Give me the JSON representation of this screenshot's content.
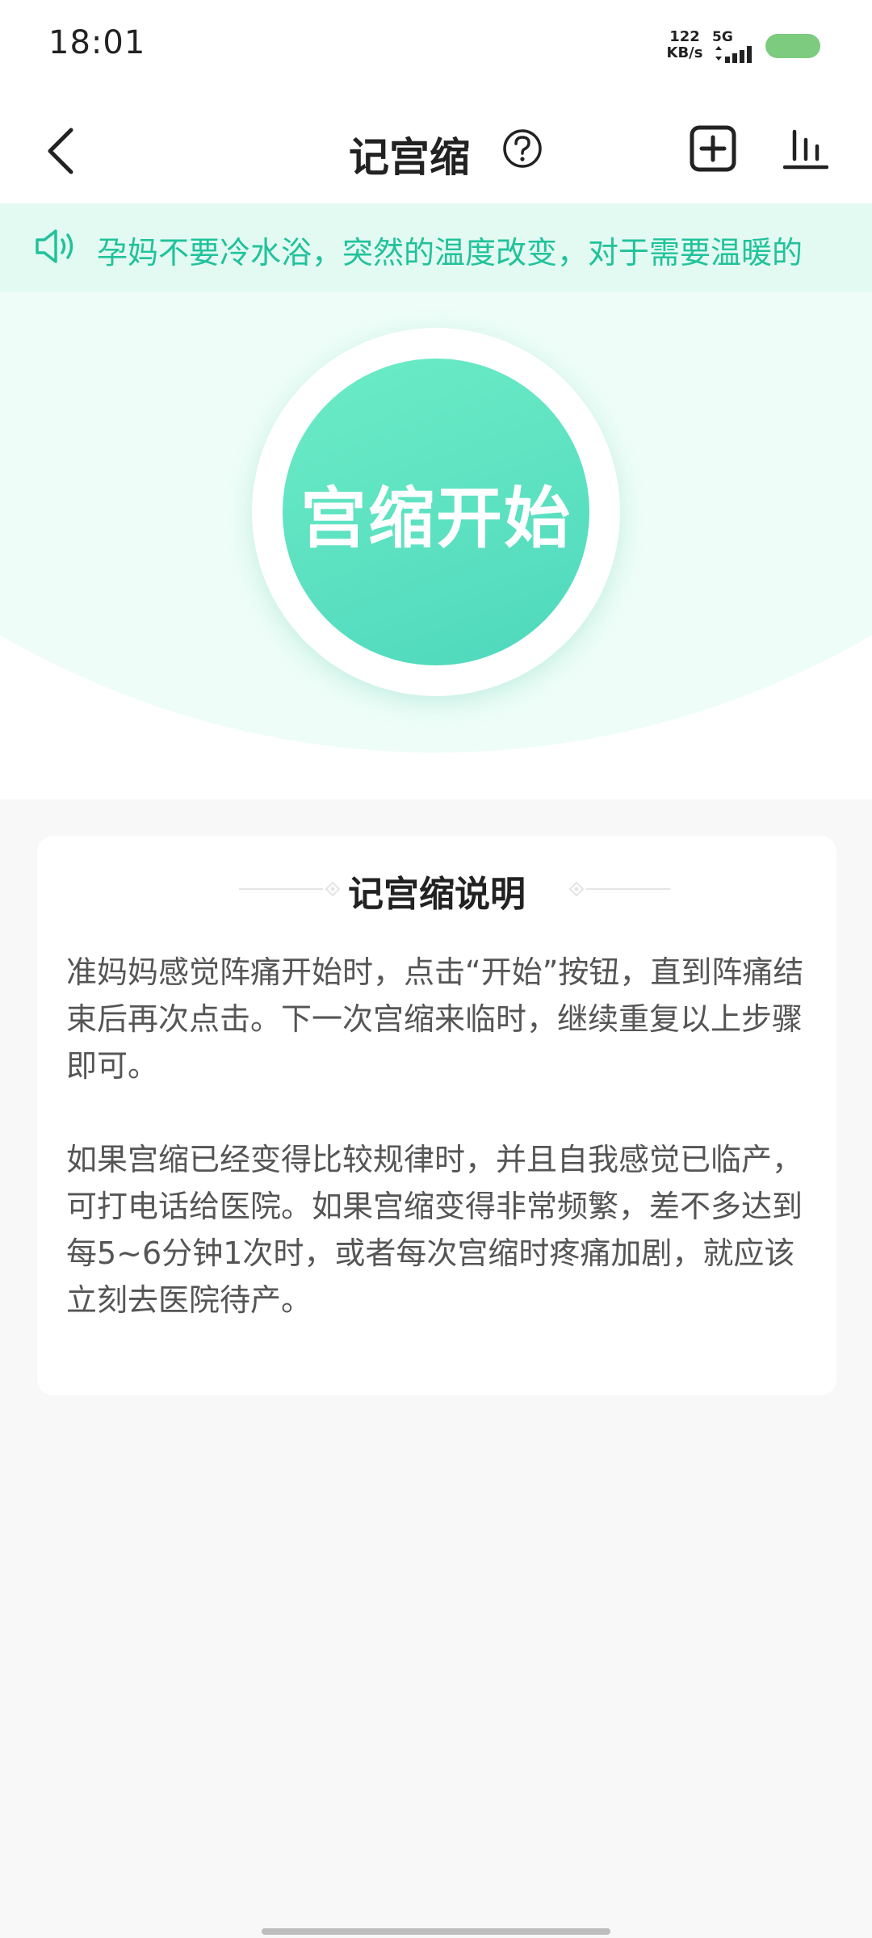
{
  "status_bar": {
    "time": "18:01",
    "net_speed_value": "122",
    "net_speed_unit": "KB/s",
    "network_type": "5G",
    "battery_color": "#7dcb7f"
  },
  "nav": {
    "title": "记宫缩",
    "icons": [
      "back-icon",
      "help-icon",
      "add-icon",
      "stats-icon"
    ]
  },
  "notice": {
    "text": "孕妈不要冷水浴，突然的温度改变，对于需要温暖的",
    "color": "#21c29a"
  },
  "hero": {
    "start_label": "宫缩开始",
    "accent": "#4fd8bd"
  },
  "card": {
    "title": "记宫缩说明",
    "paragraphs": [
      "准妈妈感觉阵痛开始时，点击“开始”按钮，直到阵痛结束后再次点击。下一次宫缩来临时，继续重复以上步骤即可。",
      "如果宫缩已经变得比较规律时，并且自我感觉已临产，可打电话给医院。如果宫缩变得非常频繁，差不多达到每5~6分钟1次时，或者每次宫缩时疼痛加剧，就应该立刻去医院待产。"
    ]
  }
}
